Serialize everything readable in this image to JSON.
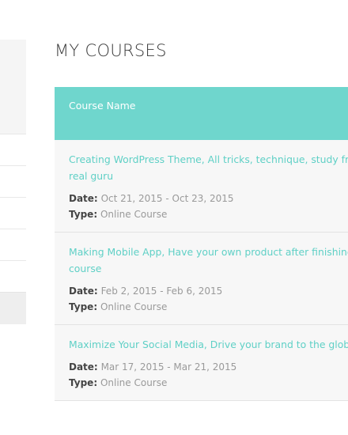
{
  "page": {
    "title": "MY COURSES"
  },
  "table": {
    "header": "Course Name",
    "date_label": "Date:",
    "type_label": "Type:",
    "rows": [
      {
        "title": "Creating WordPress Theme, All tricks, technique, study from real guru",
        "date": "Oct 21, 2015 - Oct 23, 2015",
        "type": "Online Course"
      },
      {
        "title": "Making Mobile App, Have your own product after finishing this course",
        "date": "Feb 2, 2015 - Feb 6, 2015",
        "type": "Online Course"
      },
      {
        "title": "Maximize Your Social Media, Drive your brand to the global market",
        "date": "Mar 17, 2015 - Mar 21, 2015",
        "type": "Online Course"
      }
    ]
  },
  "colors": {
    "accent": "#6fd6cd",
    "link": "#5fd0c6",
    "row_bg": "#f7f7f7",
    "label": "#444444",
    "value": "#9a9a9a"
  }
}
